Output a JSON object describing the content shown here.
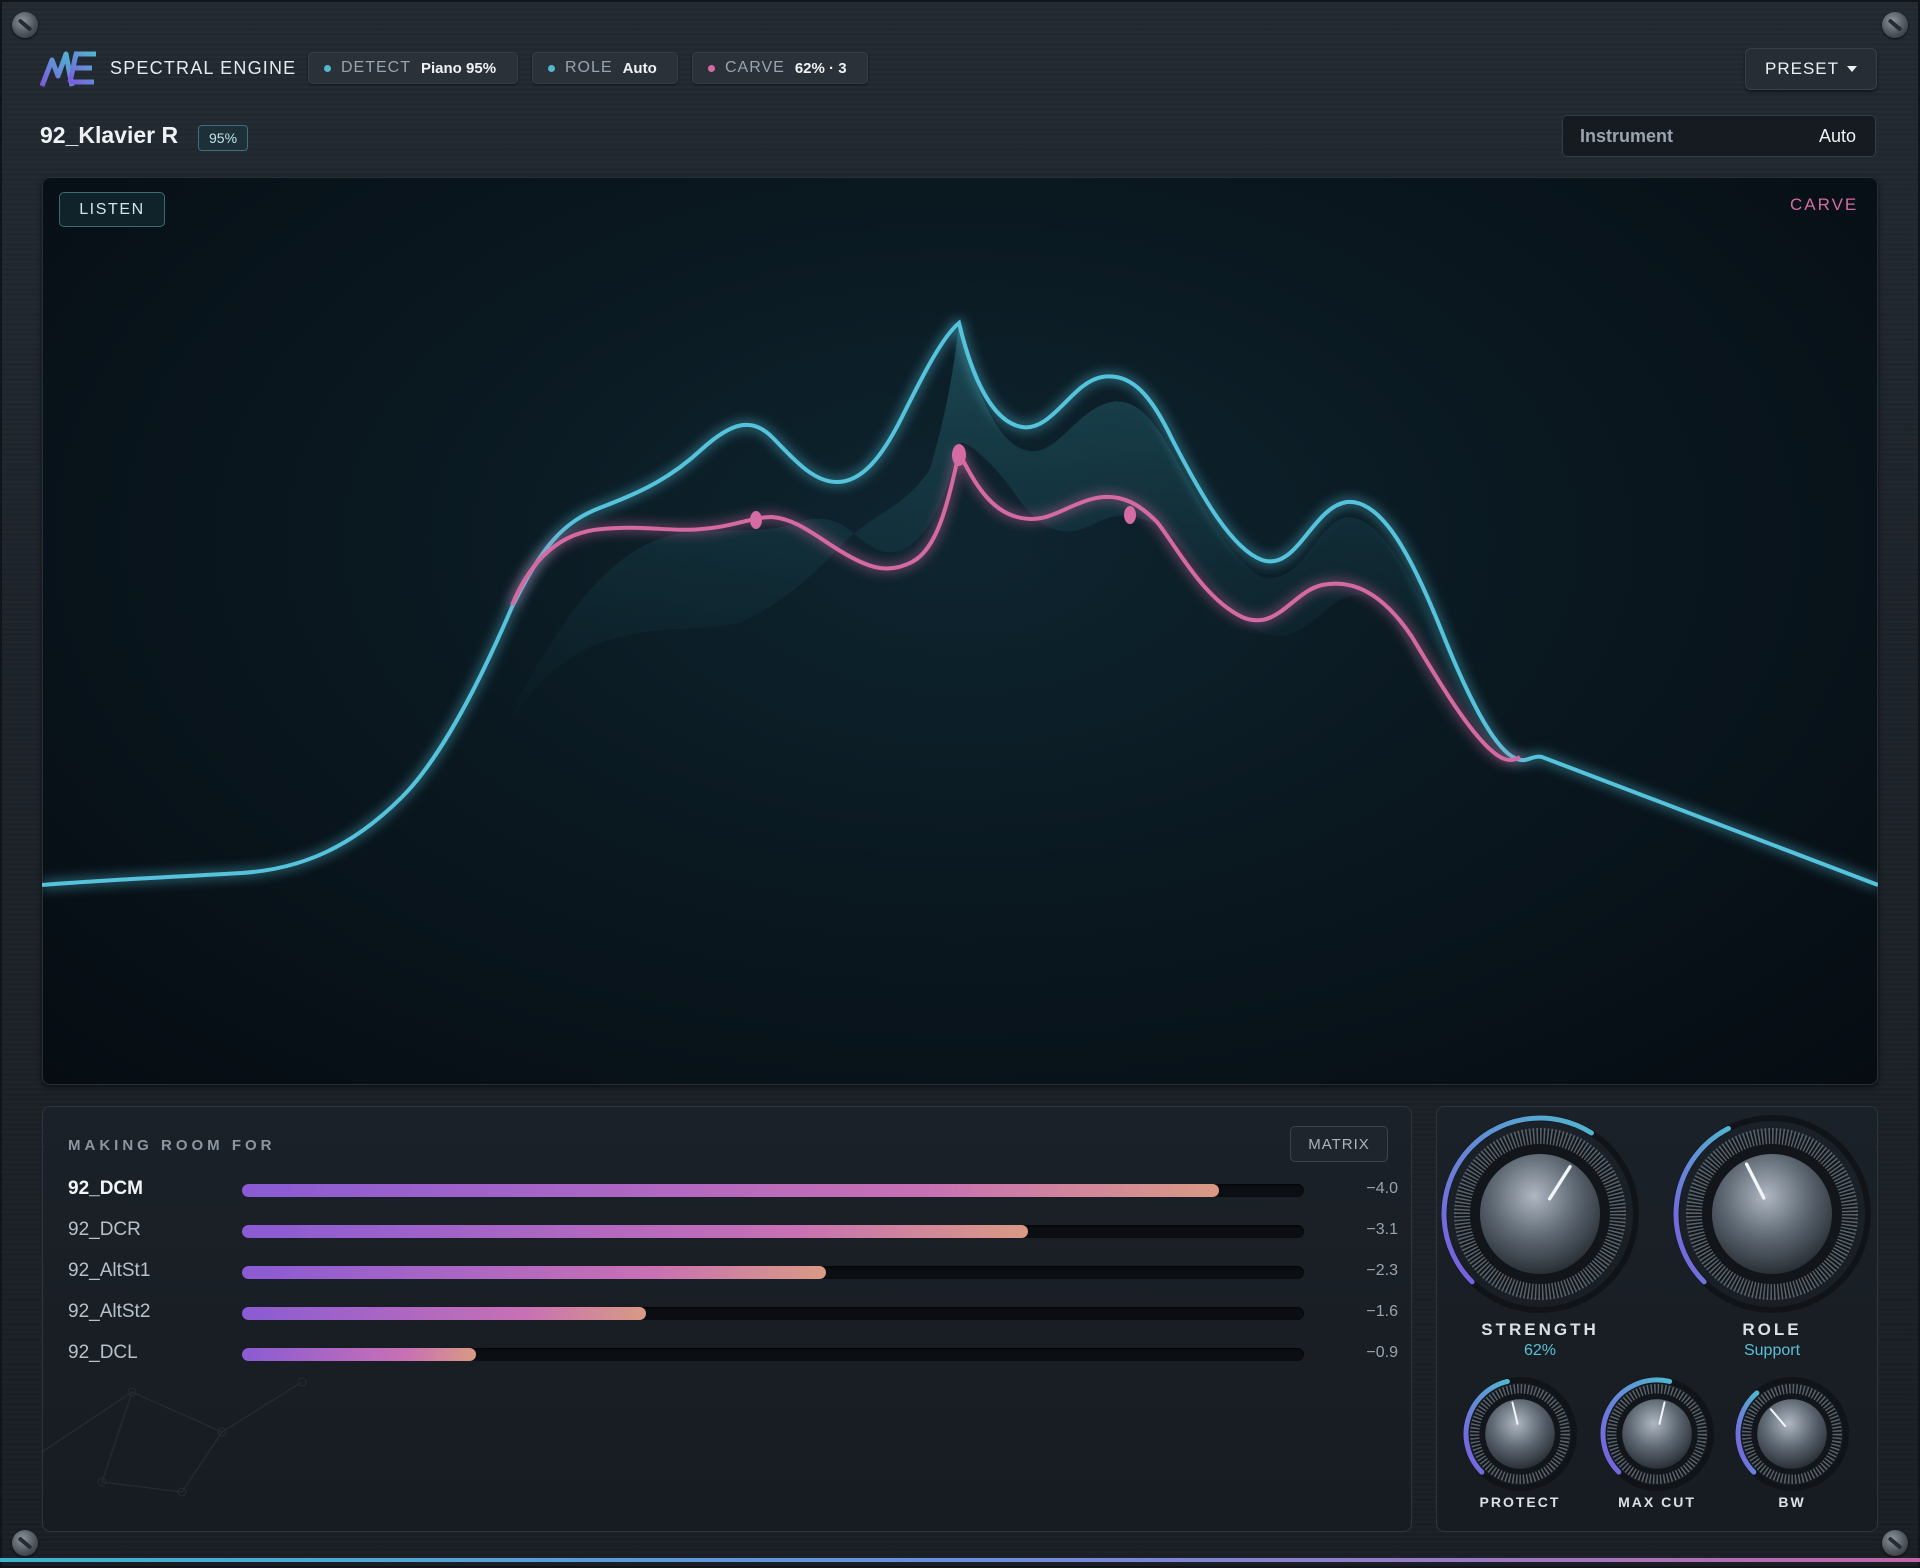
{
  "app": {
    "name": "SPECTRAL ENGINE"
  },
  "status": {
    "detect": {
      "label": "DETECT",
      "value": "Piano 95%",
      "color": "#4fb8cf"
    },
    "role": {
      "label": "ROLE",
      "value": "Auto",
      "color": "#4fb8cf"
    },
    "carve": {
      "label": "CARVE",
      "value": "62% · 3",
      "color": "#d56ba3"
    }
  },
  "preset": {
    "label": "PRESET"
  },
  "track": {
    "name": "92_Klavier R",
    "confidence": "95%"
  },
  "instrument": {
    "label": "Instrument",
    "value": "Auto"
  },
  "spectrum": {
    "listen_label": "LISTEN",
    "carve_label": "CARVE",
    "colors": {
      "source": "#55c3dc",
      "carve": "#d56ba3"
    }
  },
  "making_room": {
    "title": "MAKING ROOM FOR",
    "matrix_label": "MATRIX",
    "rows": [
      {
        "name": "92_DCM",
        "db": "−4.0",
        "level": 0.92
      },
      {
        "name": "92_DCR",
        "db": "−3.1",
        "level": 0.74
      },
      {
        "name": "92_AltSt1",
        "db": "−2.3",
        "level": 0.55
      },
      {
        "name": "92_AltSt2",
        "db": "−1.6",
        "level": 0.38
      },
      {
        "name": "92_DCL",
        "db": "−0.9",
        "level": 0.22
      }
    ]
  },
  "knobs": {
    "strength": {
      "label": "STRENGTH",
      "value": "62%",
      "level": 0.62
    },
    "role": {
      "label": "ROLE",
      "value": "Support",
      "level": 0.4
    },
    "protect": {
      "label": "PROTECT",
      "level": 0.45
    },
    "max_cut": {
      "label": "MAX CUT",
      "level": 0.55
    },
    "bw": {
      "label": "BW",
      "level": 0.35
    }
  }
}
